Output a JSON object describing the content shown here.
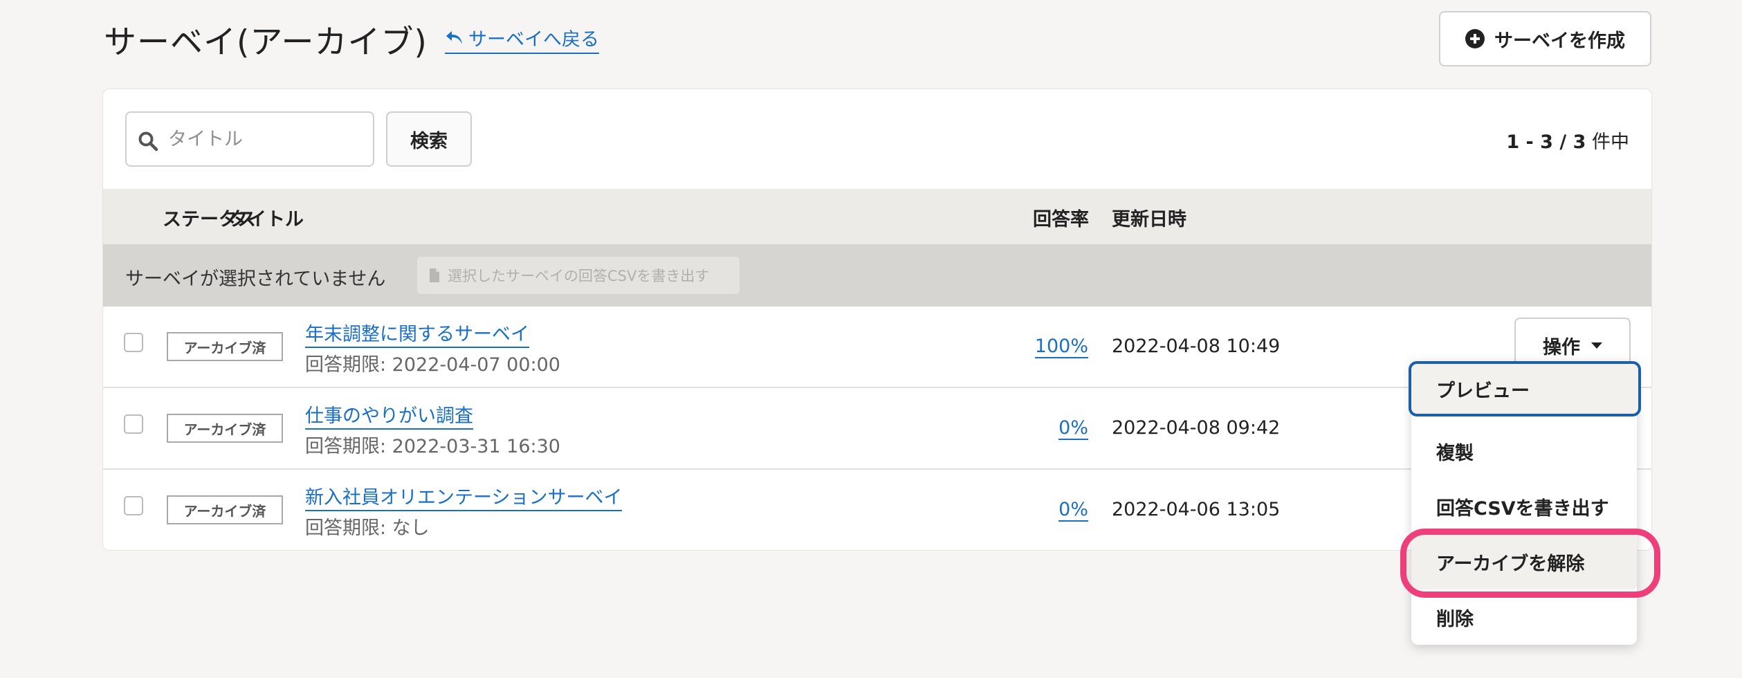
{
  "header": {
    "title": "サーベイ(アーカイブ)",
    "back_link": "サーベイへ戻る",
    "create_button": "サーベイを作成"
  },
  "search": {
    "placeholder": "タイトル",
    "value": "",
    "button": "検索"
  },
  "pagination": {
    "range": "1 - 3 / 3",
    "suffix": "件中"
  },
  "table": {
    "headers": {
      "status": "ステータス",
      "title": "タイトル",
      "rate": "回答率",
      "updated": "更新日時"
    },
    "selection_text": "サーベイが選択されていません",
    "export_selected_button": "選択したサーベイの回答CSVを書き出す",
    "rows": [
      {
        "status": "アーカイブ済",
        "title": "年末調整に関するサーベイ",
        "deadline": "回答期限: 2022-04-07 00:00",
        "rate": "100%",
        "updated": "2022-04-08  10:49",
        "action_button": "操作"
      },
      {
        "status": "アーカイブ済",
        "title": "仕事のやりがい調査",
        "deadline": "回答期限: 2022-03-31 16:30",
        "rate": "0%",
        "updated": "2022-04-08  09:42"
      },
      {
        "status": "アーカイブ済",
        "title": "新入社員オリエンテーションサーベイ",
        "deadline": "回答期限: なし",
        "rate": "0%",
        "updated": "2022-04-06  13:05"
      }
    ]
  },
  "action_menu": {
    "items": [
      "プレビュー",
      "複製",
      "回答CSVを書き出す",
      "アーカイブを解除",
      "削除"
    ],
    "focused_item": "プレビュー",
    "highlighted_item": "アーカイブを解除",
    "highlight_color": "#ef3f7b"
  },
  "colors": {
    "link": "#1a6fc4",
    "page_background": "#f6f5f3",
    "header_row": "#ecebe7",
    "selection_bar": "#d6d5d1"
  }
}
